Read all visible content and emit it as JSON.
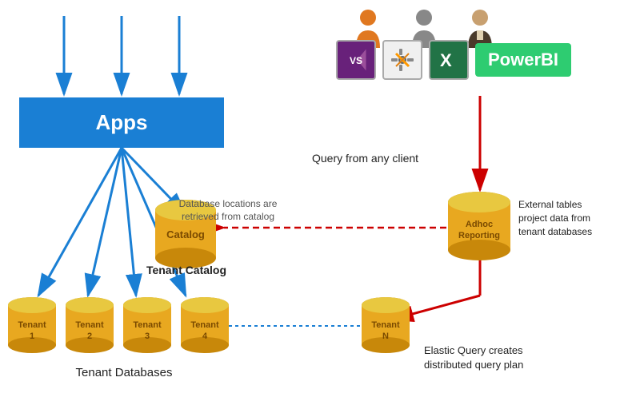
{
  "apps": {
    "label": "Apps"
  },
  "catalog": {
    "label": "Catalog"
  },
  "adhoc": {
    "label1": "Adhoc",
    "label2": "Reporting"
  },
  "tenants": [
    {
      "label": "Tenant\n1"
    },
    {
      "label": "Tenant\n2"
    },
    {
      "label": "Tenant\n3"
    },
    {
      "label": "Tenant\n4"
    }
  ],
  "tenantN": {
    "label": "Tenant\nN"
  },
  "labels": {
    "tenant_databases": "Tenant Databases",
    "tenant_catalog": "Tenant Catalog",
    "query_client": "Query from any client",
    "db_locations": "Database locations are\nretrieved from catalog",
    "external_tables": "External tables\nproject data from\ntenant databases",
    "elastic_query": "Elastic Query creates\ndistributed query plan"
  },
  "tools": [
    {
      "name": "Visual Studio",
      "symbol": "VS",
      "color": "#68217a",
      "text_color": "#fff"
    },
    {
      "name": "Settings Tool",
      "symbol": "⚙",
      "color": "#f0f0f0",
      "text_color": "#333"
    },
    {
      "name": "Excel",
      "symbol": "X",
      "color": "#217346",
      "text_color": "#fff"
    }
  ],
  "powerbi": {
    "label": "PowerBI",
    "bg": "#00a651"
  },
  "colors": {
    "apps_blue": "#1a7fd4",
    "cylinder_gold": "#e8a820",
    "cylinder_dark": "#c8880a",
    "arrow_blue": "#1a7fd4",
    "arrow_red": "#cc0000",
    "arrow_dashed": "#cc0000"
  }
}
